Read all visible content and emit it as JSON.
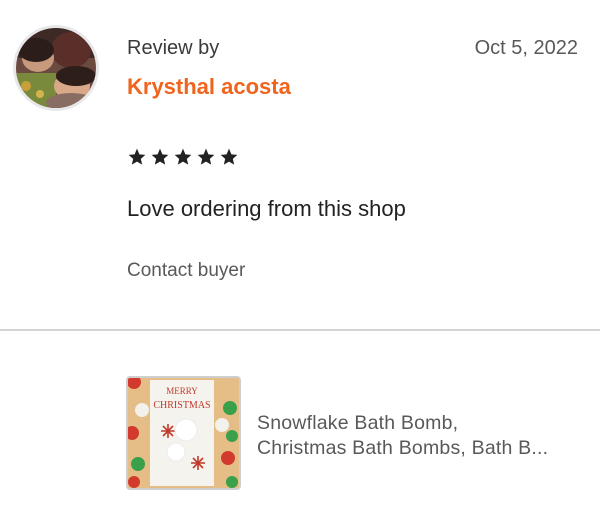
{
  "review": {
    "label": "Review by",
    "buyer_name": "Krysthal acosta",
    "date": "Oct 5, 2022",
    "rating": 5,
    "text": "Love ordering from this shop",
    "contact_label": "Contact buyer"
  },
  "product": {
    "title_line1": "Snowflake Bath Bomb,",
    "title_line2": "Christmas Bath Bombs, Bath B...",
    "thumb_card_line1": "MERRY",
    "thumb_card_line2": "CHRISTMAS"
  },
  "colors": {
    "accent": "#f1641e",
    "star": "#222222",
    "divider": "#d4d4d4"
  },
  "icons": {
    "star": "star-filled-icon"
  }
}
